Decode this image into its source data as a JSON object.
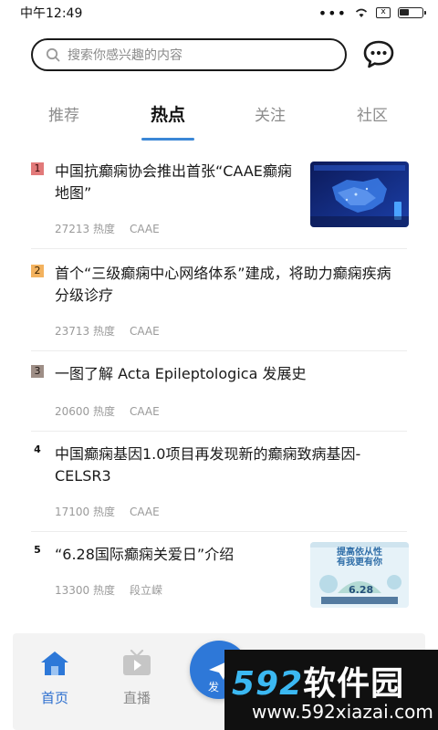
{
  "status": {
    "time": "中午12:49",
    "x_badge": "x"
  },
  "search": {
    "placeholder": "搜索你感兴趣的内容"
  },
  "tabs": [
    {
      "label": "推荐",
      "active": false
    },
    {
      "label": "热点",
      "active": true
    },
    {
      "label": "关注",
      "active": false
    },
    {
      "label": "社区",
      "active": false
    }
  ],
  "feed": [
    {
      "rank": "1",
      "title_line1": "中国抗癫痫协会推出首张“CAAE癫痫",
      "title_line2": "地图”",
      "heat": "27213 热度",
      "source": "CAAE",
      "has_thumb": true
    },
    {
      "rank": "2",
      "title_line1": "首个“三级癫痫中心网络体系”建成，将助力癫痫疾病",
      "title_line2": "分级诊疗",
      "heat": "23713 热度",
      "source": "CAAE",
      "has_thumb": false
    },
    {
      "rank": "3",
      "title_line1": "一图了解 Acta Epileptologica 发展史",
      "title_line2": "",
      "heat": "20600 热度",
      "source": "CAAE",
      "has_thumb": false
    },
    {
      "rank": "4",
      "title_line1": "中国癫痫基因1.0项目再发现新的癫痫致病基因-",
      "title_line2": "CELSR3",
      "heat": "17100 热度",
      "source": "CAAE",
      "has_thumb": false
    },
    {
      "rank": "5",
      "title_line1": "“6.28国际癫痫关爱日”介绍",
      "title_line2": "",
      "heat": "13300 热度",
      "source": "段立嵘",
      "has_thumb": true
    }
  ],
  "thumb2": {
    "headline_line1": "提高依从性",
    "headline_line2": "有我更有你",
    "date": "6.28"
  },
  "bottom_nav": {
    "home": "首页",
    "live": "直播",
    "post": "发"
  },
  "watermark": {
    "brand_num": "592",
    "brand_cn": "软件园",
    "url": "www.592xiazai.com"
  },
  "colors": {
    "accent": "#3b87d6",
    "rank1": "#e27a7a",
    "rank2": "#f3b25e",
    "rank3": "#9e8e86",
    "nav_active": "#2d6fcf"
  }
}
